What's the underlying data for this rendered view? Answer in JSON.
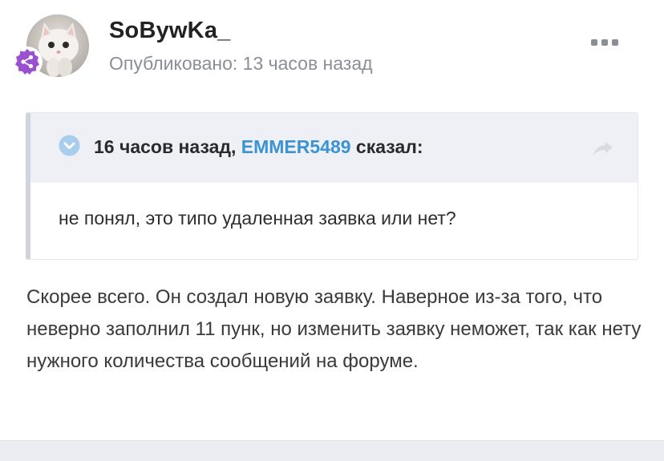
{
  "post": {
    "author": "SoBywKa_",
    "published": "Опубликовано: 13 часов назад",
    "quote": {
      "time": "16 часов назад",
      "separator": ", ",
      "user": "EMMER5489",
      "said": " сказал:",
      "text": "не понял, это типо удаленная заявка или нет?"
    },
    "content": "Скорее всего. Он создал новую заявку. Наверное из-за того, что неверно заполнил 11 пунк, но изменить заявку неможет, так как нету нужного количества сообщений на форуме."
  },
  "icons": {
    "avatar": "kitten-avatar",
    "badge": "share-network-icon",
    "menu": "more-options-icon",
    "quote_check": "chevron-down-circle-icon",
    "quote_share": "share-arrow-icon"
  },
  "colors": {
    "accent": "#3a93d4",
    "badge": "#9b4fd1",
    "text": "#3a3a3a",
    "muted": "#8a8e96",
    "quote_bg": "#eef0f5"
  }
}
